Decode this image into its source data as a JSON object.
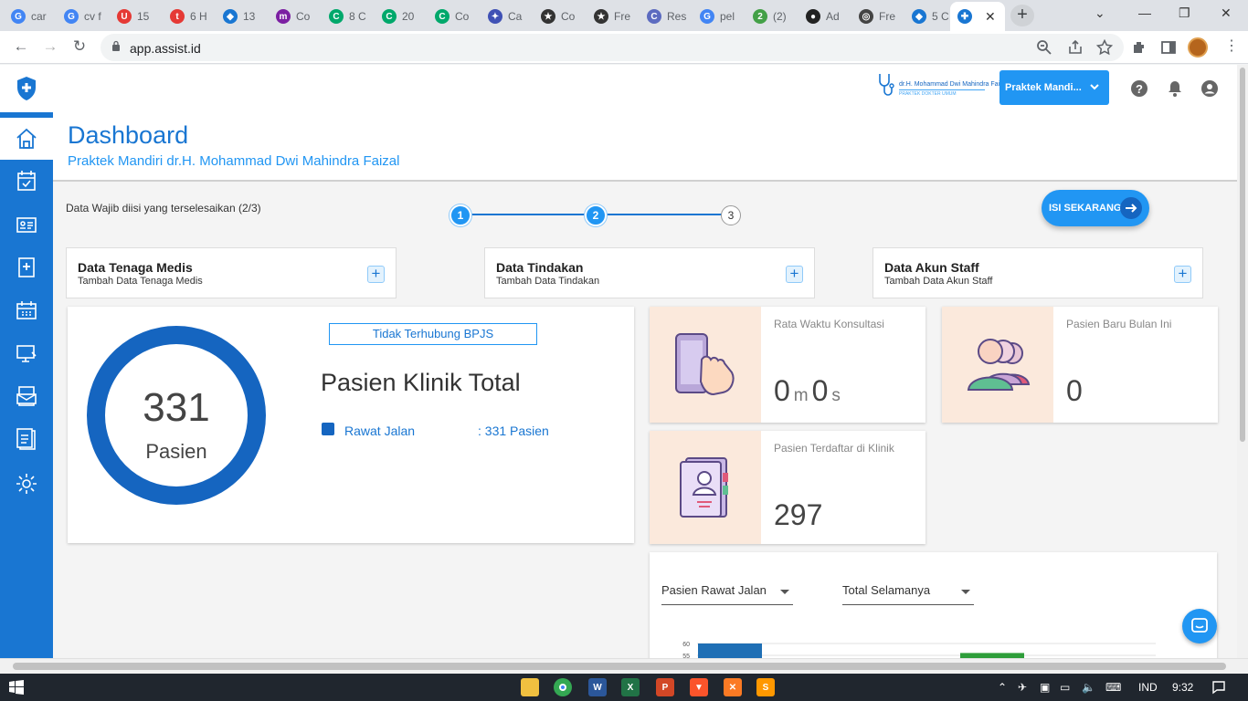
{
  "browser": {
    "tabs": [
      {
        "label": "car",
        "favicon": "G",
        "color": "#4285f4",
        "x": 4,
        "w": 58
      },
      {
        "label": "cv f",
        "favicon": "G",
        "color": "#4285f4",
        "x": 62,
        "w": 58
      },
      {
        "label": "15",
        "favicon": "U",
        "color": "#e53935",
        "x": 120,
        "w": 58
      },
      {
        "label": "6 H",
        "favicon": "t",
        "color": "#e53935",
        "x": 178,
        "w": 58
      },
      {
        "label": "13",
        "favicon": "◆",
        "color": "#1976d2",
        "x": 236,
        "w": 58
      },
      {
        "label": "Co",
        "favicon": "m",
        "color": "#7b1fa2",
        "x": 294,
        "w": 58
      },
      {
        "label": "8 C",
        "favicon": "C",
        "color": "#00a86b",
        "x": 352,
        "w": 58
      },
      {
        "label": "20",
        "favicon": "C",
        "color": "#00a86b",
        "x": 410,
        "w": 58
      },
      {
        "label": "Co",
        "favicon": "C",
        "color": "#00a86b",
        "x": 468,
        "w": 58
      },
      {
        "label": "Ca",
        "favicon": "✦",
        "color": "#3f51b5",
        "x": 526,
        "w": 58
      },
      {
        "label": "Co",
        "favicon": "★",
        "color": "#333333",
        "x": 584,
        "w": 58
      },
      {
        "label": "Fre",
        "favicon": "★",
        "color": "#333333",
        "x": 642,
        "w": 58
      },
      {
        "label": "Res",
        "favicon": "C",
        "color": "#5c6bc0",
        "x": 700,
        "w": 58
      },
      {
        "label": "pel",
        "favicon": "G",
        "color": "#4285f4",
        "x": 758,
        "w": 58
      },
      {
        "label": "(2)",
        "favicon": "2",
        "color": "#43a047",
        "x": 816,
        "w": 58
      },
      {
        "label": "Ad",
        "favicon": "●",
        "color": "#222222",
        "x": 874,
        "w": 58
      },
      {
        "label": "Fre",
        "favicon": "◎",
        "color": "#444444",
        "x": 932,
        "w": 58
      },
      {
        "label": "5 C",
        "favicon": "◆",
        "color": "#1976d2",
        "x": 990,
        "w": 48
      }
    ],
    "active_tab_close": "✕",
    "new_tab": "+",
    "url": "app.assist.id"
  },
  "header": {
    "brand_line1": "dr.H. Mohammad Dwi Mahindra Faizal",
    "brand_line2": "PRAKTEK DOKTER UMUM",
    "practice_label": "Praktek Mandi..."
  },
  "page": {
    "title": "Dashboard",
    "subtitle": "Praktek Mandiri dr.H. Mohammad Dwi Mahindra Faizal"
  },
  "progress": {
    "text": "Data Wajib diisi yang terselesaikan (2/3)",
    "steps": [
      "1",
      "2",
      "3"
    ],
    "cta_label": "ISI SEKARANG"
  },
  "tasks": [
    {
      "title": "Data Tenaga Medis",
      "subtitle": "Tambah Data Tenaga Medis"
    },
    {
      "title": "Data Tindakan",
      "subtitle": "Tambah Data Tindakan"
    },
    {
      "title": "Data Akun Staff",
      "subtitle": "Tambah Data Akun Staff"
    }
  ],
  "patients": {
    "total": "331",
    "unit": "Pasien",
    "bpjs_status": "Tidak Terhubung BPJS",
    "heading": "Pasien Klinik Total",
    "legend_name": "Rawat Jalan",
    "legend_value": ": 331 Pasien",
    "color": "#1565c0"
  },
  "stats": {
    "consult_label": "Rata Waktu Konsultasi",
    "consult_min": "0",
    "consult_min_unit": "m",
    "consult_sec": "0",
    "consult_sec_unit": "s",
    "new_label": "Pasien Baru Bulan Ini",
    "new_value": "0",
    "registered_label": "Pasien Terdaftar di Klinik",
    "registered_value": "297"
  },
  "filters": {
    "type": "Pasien Rawat Jalan",
    "period": "Total Selamanya"
  },
  "chart_data": {
    "type": "bar",
    "categories": [
      "",
      ""
    ],
    "values": [
      60,
      56
    ],
    "colors": [
      "#1f6fb5",
      "#2e9e3a"
    ],
    "yticks": [
      "60",
      "55"
    ],
    "ylim": [
      55,
      60
    ],
    "grid": true
  },
  "taskbar": {
    "lang": "IND",
    "time": "9:32"
  }
}
